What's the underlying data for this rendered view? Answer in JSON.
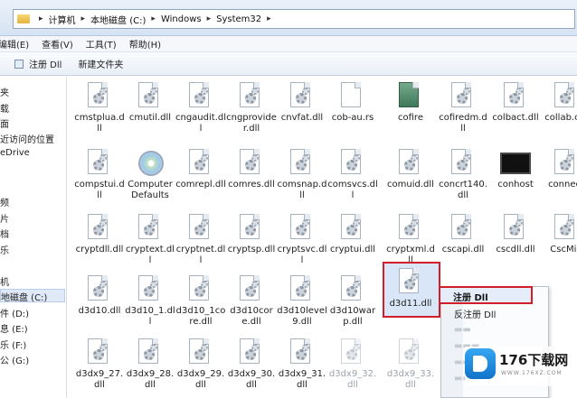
{
  "address": {
    "crumbs": [
      "计算机",
      "本地磁盘 (C:)",
      "Windows",
      "System32"
    ]
  },
  "menubar": {
    "items": [
      "编辑(E)",
      "查看(V)",
      "工具(T)",
      "帮助(H)"
    ]
  },
  "toolbar": {
    "register_label": "注册 Dll",
    "new_folder_label": "新建文件夹"
  },
  "navpane": {
    "items": [
      "夹",
      "载",
      "面",
      "近访问的位置",
      "eDrive",
      "频",
      "片",
      "档",
      "乐",
      "机",
      "地磁盘 (C:)",
      "件 (D:)",
      "息 (E:)",
      "乐 (F:)",
      "公 (G:)"
    ]
  },
  "files": {
    "row1": [
      "cmstplua.dll",
      "cmutil.dll",
      "cngaudit.dll",
      "cngprovider.dll",
      "cnvfat.dll",
      "cob-au.rs",
      "cofire",
      "cofiredm.dll",
      "colbact.dll",
      "collab.cpl"
    ],
    "row2": [
      "compstui.dll",
      "Computer Defaults",
      "comrepl.dll",
      "comres.dll",
      "comsnap.dll",
      "comsvcs.dll",
      "comuid.dll",
      "concrt140.dll",
      "conhost",
      "connect"
    ],
    "row3": [
      "cryptdll.dll",
      "cryptext.dll",
      "cryptnet.dll",
      "cryptsp.dll",
      "cryptsvc.dll",
      "cryptui.dll",
      "cryptxml.dll",
      "cscapi.dll",
      "cscdll.dll",
      "CscMig"
    ],
    "row4": [
      "d3d10.dll",
      "d3d10_1.dll",
      "d3d10_1core.dll",
      "d3d10core.dll",
      "d3d10level9.dll",
      "d3d10warp.dll",
      "d3d11.dll"
    ],
    "row5": [
      "d3dx9_27.dll",
      "d3dx9_28.dll",
      "d3dx9_29.dll",
      "d3dx9_30.dll",
      "d3dx9_31.dll",
      "d3dx9_32.dll",
      "d3dx9_33.dll"
    ]
  },
  "context_menu": {
    "register": "注册 Dll",
    "unregister": "反注册 Dll",
    "ghost_items": [
      "",
      "",
      "",
      ""
    ]
  },
  "watermark": {
    "brand": "176下载网",
    "url": "WWW.176XZ.COM"
  }
}
